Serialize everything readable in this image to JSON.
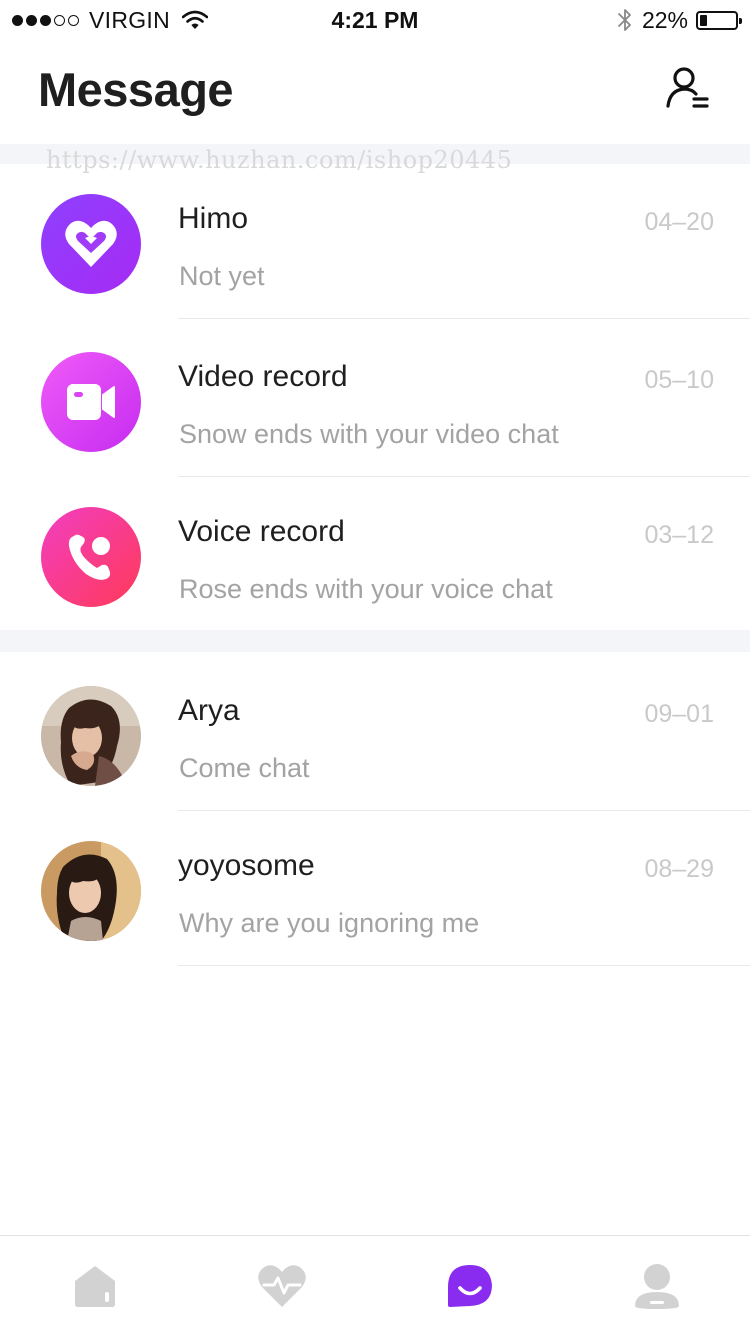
{
  "status_bar": {
    "carrier": "VIRGIN",
    "signal_bars_filled": 3,
    "signal_bars_total": 5,
    "time": "4:21 PM",
    "battery_percent_text": "22%",
    "battery_level": 0.22,
    "icons": [
      "wifi-icon",
      "bluetooth-icon",
      "battery-icon"
    ]
  },
  "header": {
    "title": "Message",
    "contacts_icon": "user-list-icon"
  },
  "watermark": "https://www.huzhan.com/ishop20445",
  "system_messages": [
    {
      "name": "Himo",
      "preview": "Not yet",
      "date": "04–20",
      "icon": "heart-icon",
      "color": "#9b36fb"
    },
    {
      "name": "Video record",
      "preview": "Snow ends with your video chat",
      "date": "05–10",
      "icon": "video-camera-icon",
      "color": "#dc45f6"
    },
    {
      "name": "Voice record",
      "preview": "Rose ends with your voice chat",
      "date": "03–12",
      "icon": "phone-icon",
      "color": "#fb3d7d"
    }
  ],
  "conversations": [
    {
      "name": "Arya",
      "preview": "Come chat",
      "date": "09–01"
    },
    {
      "name": "yoyosome",
      "preview": "Why are you ignoring me",
      "date": "08–29"
    }
  ],
  "tab_bar": {
    "tabs": [
      {
        "id": "home",
        "icon": "home-icon",
        "active": false
      },
      {
        "id": "heart",
        "icon": "heart-pulse-icon",
        "active": false
      },
      {
        "id": "message",
        "icon": "message-smile-icon",
        "active": true
      },
      {
        "id": "profile",
        "icon": "profile-icon",
        "active": false
      }
    ],
    "active_color": "#8a2cf0",
    "inactive_color": "#d2d2d2"
  }
}
